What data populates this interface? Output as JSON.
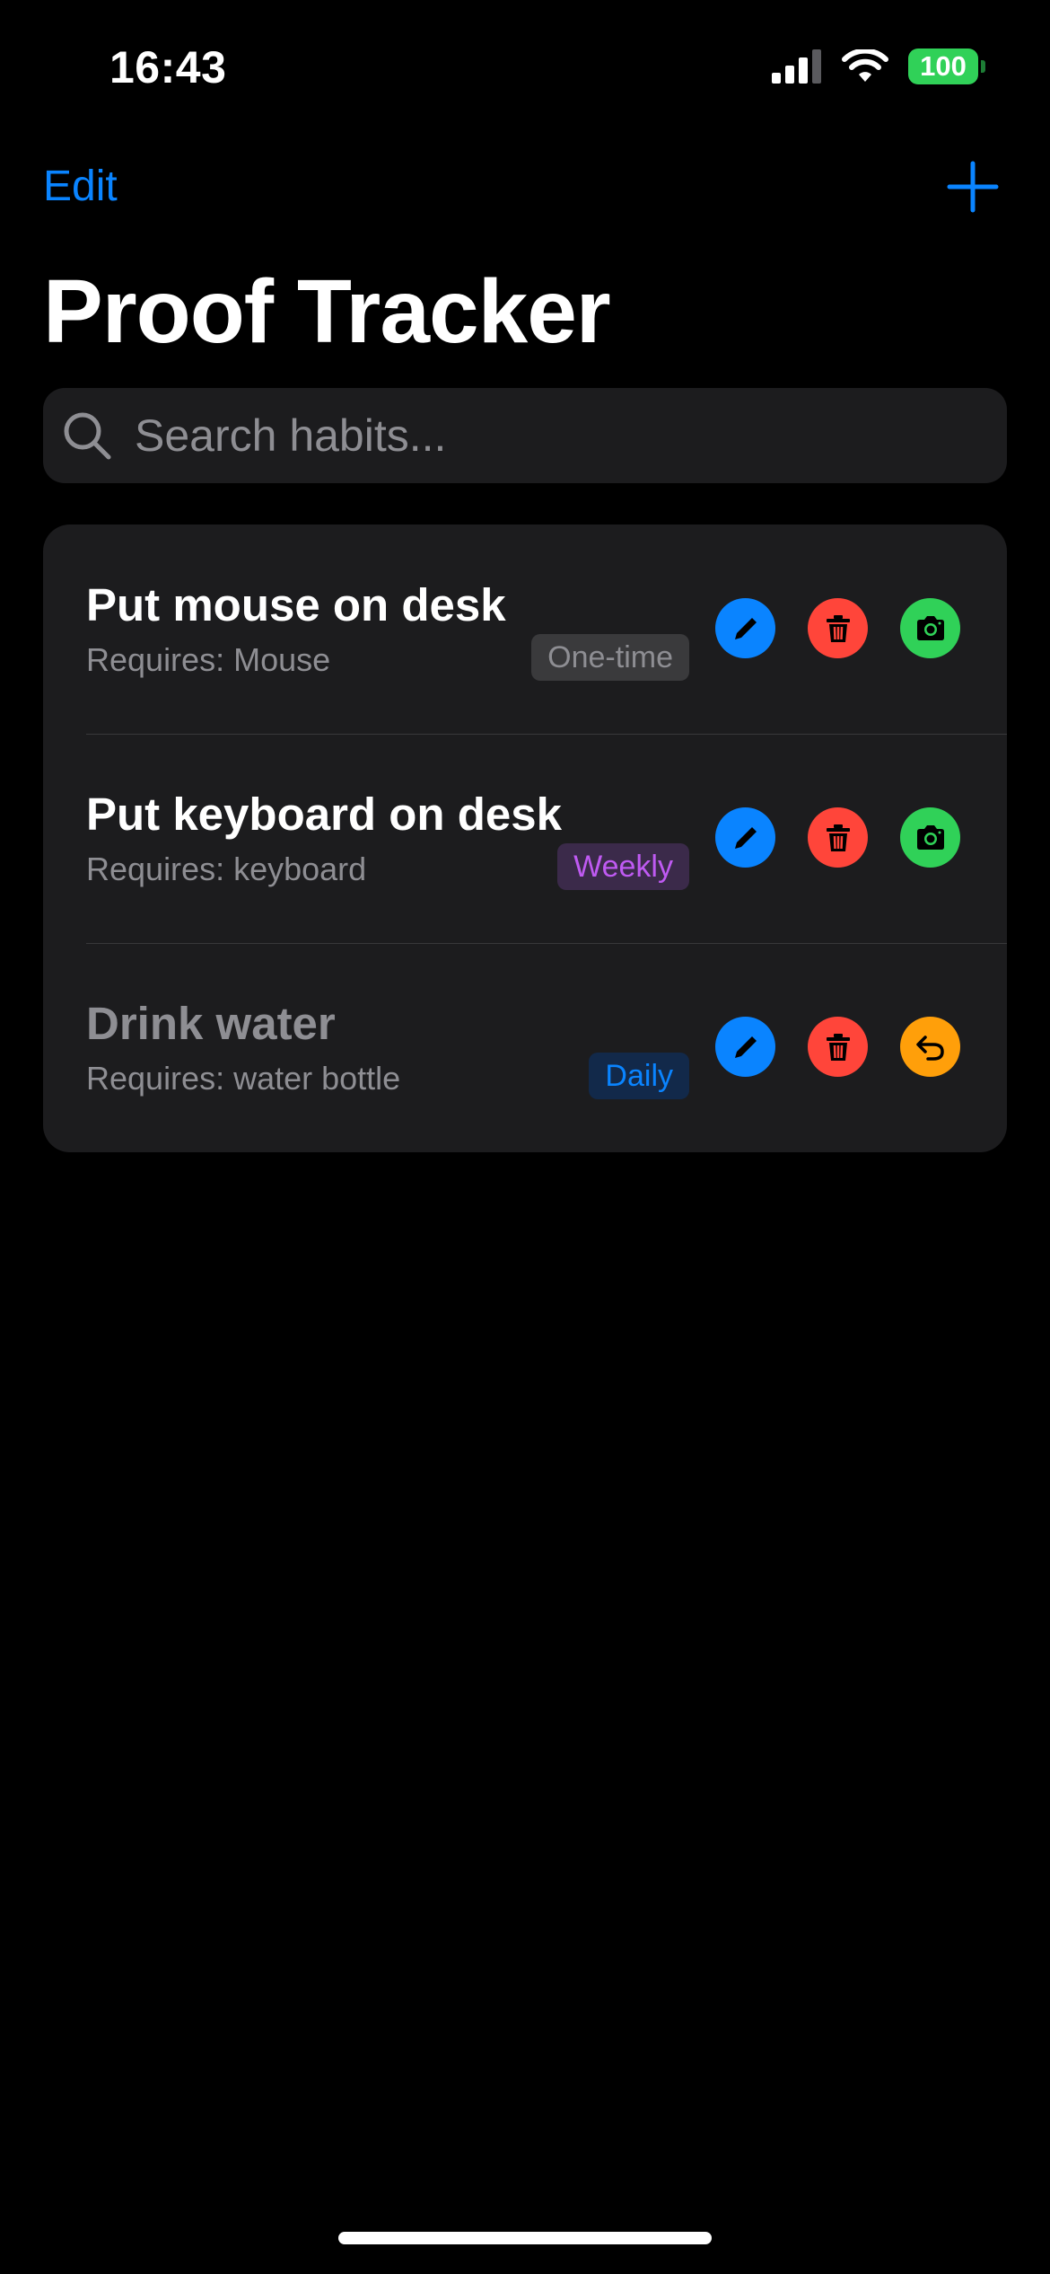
{
  "status_bar": {
    "time": "16:43",
    "battery": "100"
  },
  "nav": {
    "edit_label": "Edit"
  },
  "page_title": "Proof Tracker",
  "search": {
    "placeholder": "Search habits..."
  },
  "habits": [
    {
      "title": "Put mouse on desk",
      "requires": "Requires: Mouse",
      "frequency": "One-time",
      "status_action": "camera-icon"
    },
    {
      "title": "Put keyboard on desk",
      "requires": "Requires: keyboard",
      "frequency": "Weekly",
      "status_action": "camera-icon"
    },
    {
      "title": "Drink water",
      "requires": "Requires: water bottle",
      "frequency": "Daily",
      "status_action": "undo-icon"
    }
  ],
  "colors": {
    "accent": "#0a84ff",
    "delete": "#ff453a",
    "camera": "#30d158",
    "undo": "#ff9f0a",
    "weekly_badge": "#bf5af2",
    "daily_badge": "#0a84ff",
    "onetime_badge": "#8e8e93"
  }
}
